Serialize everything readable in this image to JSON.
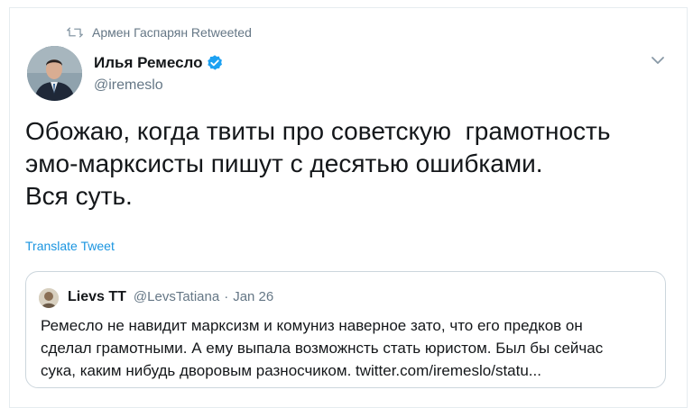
{
  "retweet": {
    "icon": "retweet-icon",
    "label": "Армен Гаспарян Retweeted"
  },
  "tweet": {
    "author_name": "Илья Ремесло",
    "verified_icon": "verified-badge-icon",
    "handle": "@iremeslo",
    "menu_icon": "chevron-down-icon",
    "text_lines": [
      "Обожаю, когда твиты про советскую  грамотность",
      "эмо-марксисты пишут с десятью ошибками.",
      "Вся суть."
    ],
    "translate_label": "Translate Tweet"
  },
  "quoted_tweet": {
    "author_name": "Lievs TT",
    "handle": "@LevsTatiana",
    "separator": "·",
    "date": "Jan 26",
    "text_lines": [
      "Ремесло не навидит марксизм и комуниз наверное зато, что его предков он",
      "сделал грамотными. А ему выпала возможнсть стать юристом. Был бы сейчас",
      "сука, каким нибудь дворовым разносчиком. twitter.com/iremeslo/statu..."
    ]
  },
  "colors": {
    "text": "#14171a",
    "secondary": "#657786",
    "link": "#1b95e0",
    "verified": "#1da1f2",
    "border": "#ccd6dd"
  }
}
